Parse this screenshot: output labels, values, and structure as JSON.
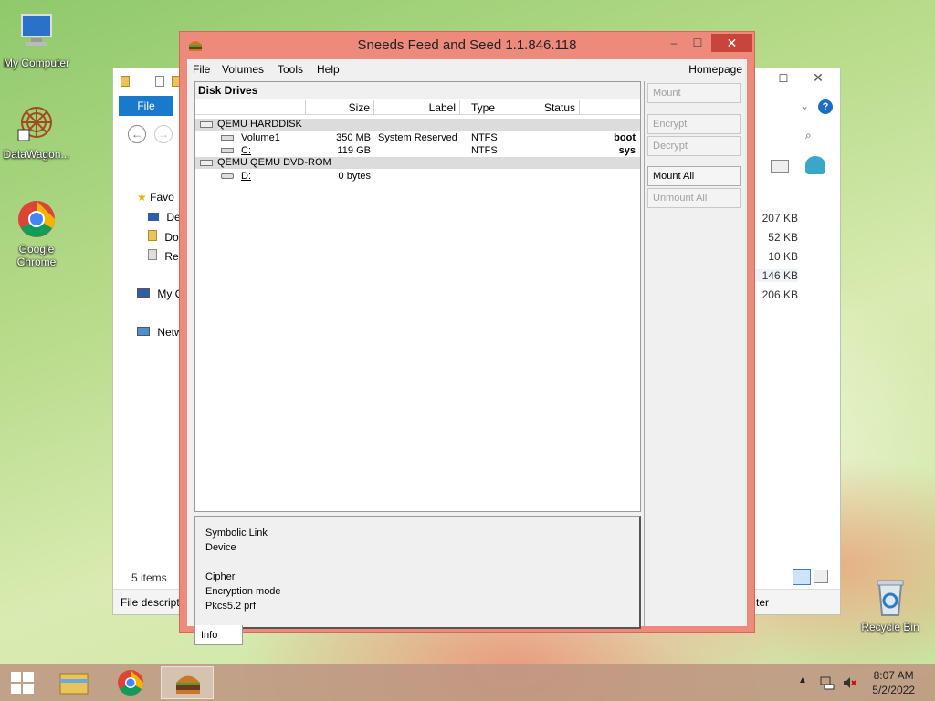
{
  "desktop": {
    "icons": [
      {
        "label": "My Computer"
      },
      {
        "label": "DataWagon..."
      },
      {
        "label": "Google Chrome"
      },
      {
        "label": "Recycle Bin"
      }
    ]
  },
  "explorer": {
    "file_tab": "File",
    "nav": {
      "favorites": "Favo",
      "desktop": "De",
      "documents": "Do",
      "recent": "Re",
      "my_computer": "My C",
      "network": "Netw"
    },
    "sizes": [
      "207 KB",
      "52 KB",
      "10 KB",
      "146 KB",
      "206 KB"
    ],
    "status_items": "5 items",
    "status_desc": "File descript",
    "status_right": "ter"
  },
  "app": {
    "title": "Sneeds Feed and Seed 1.1.846.118",
    "window_buttons": {
      "minimize": "–",
      "maximize": "☐",
      "close": "✕"
    },
    "menu": {
      "file": "File",
      "volumes": "Volumes",
      "tools": "Tools",
      "help": "Help",
      "homepage": "Homepage"
    },
    "disk_drives_header": "Disk Drives",
    "columns": {
      "size": "Size",
      "label": "Label",
      "type": "Type",
      "status": "Status"
    },
    "groups": [
      {
        "name": "QEMU HARDDISK",
        "volumes": [
          {
            "name": "Volume1",
            "size": "350 MB",
            "label": "System Reserved",
            "type": "NTFS",
            "status": "boot"
          },
          {
            "name": "C:",
            "size": "119 GB",
            "label": "",
            "type": "NTFS",
            "status": "sys"
          }
        ]
      },
      {
        "name": "QEMU QEMU DVD-ROM",
        "volumes": [
          {
            "name": "D:",
            "size": "0 bytes",
            "label": "",
            "type": "",
            "status": ""
          }
        ]
      }
    ],
    "info": {
      "symbolic_link": "Symbolic Link",
      "device": "Device",
      "cipher": "Cipher",
      "encryption_mode": "Encryption mode",
      "prf": "Pkcs5.2 prf"
    },
    "info_tab": "Info",
    "buttons": {
      "mount": "Mount",
      "encrypt": "Encrypt",
      "decrypt": "Decrypt",
      "mount_all": "Mount All",
      "unmount_all": "Unmount All"
    }
  },
  "taskbar": {
    "time": "8:07 AM",
    "date": "5/2/2022"
  }
}
